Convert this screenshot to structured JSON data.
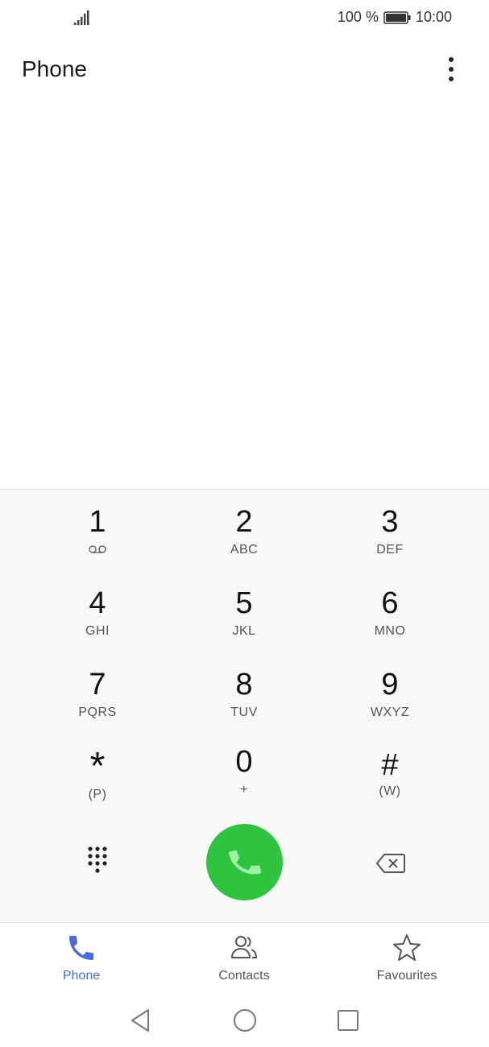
{
  "status_bar": {
    "battery_text": "100 %",
    "time": "10:00",
    "icons": [
      "signal-icon",
      "battery-icon"
    ]
  },
  "header": {
    "title": "Phone",
    "menu_icon": "more-vertical-icon"
  },
  "dialpad": {
    "keys": [
      {
        "num": "1",
        "letters": ""
      },
      {
        "num": "2",
        "letters": "ABC"
      },
      {
        "num": "3",
        "letters": "DEF"
      },
      {
        "num": "4",
        "letters": "GHI"
      },
      {
        "num": "5",
        "letters": "JKL"
      },
      {
        "num": "6",
        "letters": "MNO"
      },
      {
        "num": "7",
        "letters": "PQRS"
      },
      {
        "num": "8",
        "letters": "TUV"
      },
      {
        "num": "9",
        "letters": "WXYZ"
      },
      {
        "num": "*",
        "letters": "(P)"
      },
      {
        "num": "0",
        "letters": "+"
      },
      {
        "num": "#",
        "letters": "(W)"
      }
    ],
    "call_color": "#2ec440"
  },
  "bottom_nav": {
    "items": [
      {
        "label": "Phone",
        "icon": "phone-icon",
        "active": true
      },
      {
        "label": "Contacts",
        "icon": "contacts-icon",
        "active": false
      },
      {
        "label": "Favourites",
        "icon": "star-icon",
        "active": false
      }
    ],
    "active_color": "#4a6cd4"
  },
  "system_nav": {
    "icons": [
      "back-icon",
      "home-icon",
      "recents-icon"
    ]
  }
}
